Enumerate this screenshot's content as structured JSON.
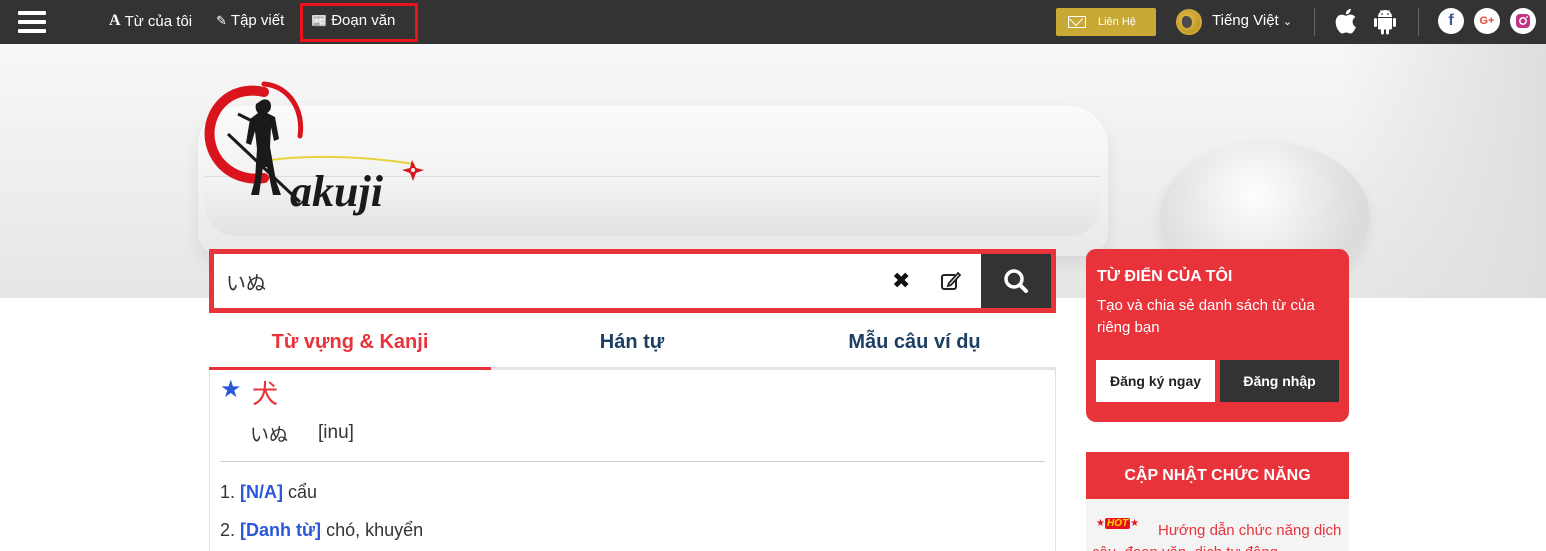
{
  "nav": {
    "my_words": "Từ của tôi",
    "writing": "Tập viết",
    "paragraph": "Đoạn văn"
  },
  "topbar": {
    "contact_label": "Liên Hệ",
    "language": "Tiếng Việt",
    "accent_color": "#c9a935",
    "social": [
      "f",
      "G+",
      "instagram-icon"
    ]
  },
  "search": {
    "value": "いぬ"
  },
  "tabs": [
    {
      "label": "Từ vựng & Kanji",
      "active": true
    },
    {
      "label": "Hán tự",
      "active": false
    },
    {
      "label": "Mẫu câu ví dụ",
      "active": false
    }
  ],
  "result": {
    "kanji": "犬",
    "reading": "いぬ",
    "romaji": "[inu]",
    "meanings": [
      {
        "num": "1.",
        "pos": "[N/A]",
        "text": "cẩu"
      },
      {
        "num": "2.",
        "pos": "[Danh từ]",
        "text": "chó, khuyển"
      }
    ]
  },
  "sidebar": {
    "dict_title": "TỪ ĐIỂN CỦA TÔI",
    "dict_desc": "Tạo và chia sẻ danh sách từ của riêng bạn",
    "register": "Đăng ký ngay",
    "login": "Đăng nhập",
    "update_title": "CẬP NHẬT CHỨC NĂNG",
    "hot_badge": "HOT",
    "update_text": "Hướng dẫn chức năng dịch câu, đoạn văn, dịch tự động"
  },
  "colors": {
    "brand_red": "#e8333b",
    "topbar": "#333333",
    "link_blue": "#2b58d8",
    "tab_text": "#1d3f63"
  }
}
